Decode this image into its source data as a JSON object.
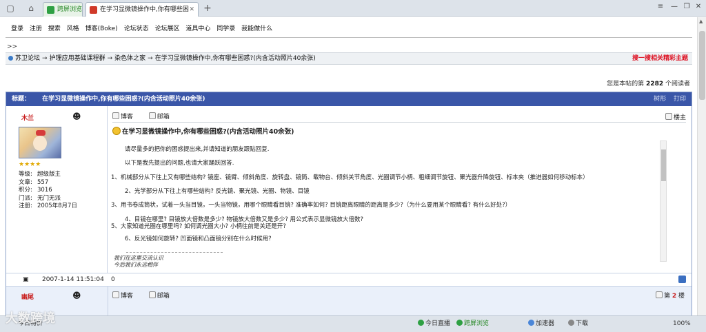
{
  "browser": {
    "tabs": [
      {
        "label": "跨屏浏览"
      },
      {
        "label": "在学习显微镜操作中,你有哪些困"
      }
    ],
    "new_tab": "+",
    "win_controls": [
      "≡",
      "—",
      "❐",
      "✕"
    ]
  },
  "topnav": [
    "登录",
    "注册",
    "搜索",
    "风格",
    "博客(Boke)",
    "论坛状态",
    "论坛展区",
    "道具中心",
    "同学录",
    "我能做什么"
  ],
  "gtgt": ">>",
  "breadcrumb": {
    "items": [
      "苏卫论坛",
      "护理应用基础课程群",
      "染色体之家",
      "在学习显微镜操作中,你有哪些困惑?(内含活动照片40余张)"
    ],
    "arrow": "→",
    "search_label": "搜一搜相关精彩主题"
  },
  "readers": {
    "prefix": "您是本帖的第",
    "count": "2282",
    "suffix": "个阅读者"
  },
  "thread": {
    "label": "标题：",
    "title": "在学习显微镜操作中,你有哪些困惑?(内含活动照片40余张)",
    "tools": [
      "树形",
      "打印"
    ]
  },
  "post1": {
    "author": "木兰",
    "stars": "★★★★",
    "info": [
      {
        "k": "等级:",
        "v": "超级版主"
      },
      {
        "k": "文章:",
        "v": "557"
      },
      {
        "k": "积分:",
        "v": "3016"
      },
      {
        "k": "门派:",
        "v": "无门无派"
      },
      {
        "k": "注册:",
        "v": "2005年8月7日"
      }
    ],
    "actions": [
      "博客",
      "邮箱"
    ],
    "floor": "楼主",
    "title": "在学习显微镜操作中,你有哪些困惑?(内含活动照片40余张)",
    "lines": [
      "请尽量多的把你的困惑提出来,并请知道的朋友跟贴回复.",
      "以下是我先提出的问题,也请大家踊跃回答.",
      "1、机械部分从下往上又有哪些结构? 镜座、镜臂、倾斜角度、旋转盘、镜筒、载物台、倾斜关节角度、光圈调节小柄、粗细调节旋钮、聚光器升降旋钮、标本夹（推进器如何移动标本）",
      "2、光学部分从下往上有哪些结构? 反光镜、聚光镜、光圈、物镜、目镜",
      "3、用书卷成筒状，试着一头当目镜，一头当物镜，用哪个眼睛看目镜? 准确率如何? 目镜距离眼睛的距离是多少?（为什么要用某个眼睛看? 有什么好处?）",
      "4、目镜在哪里? 目镜放大倍数是多少? 物镜放大倍数又是多少? 用公式表示显微镜放大倍数?",
      "5、大家知道光圈在哪里吗? 如何调光圈大小? 小柄往前是关还是开?",
      "6、反光镜如何旋转? 凹面镜和凸面镜分别在什么时候用?"
    ],
    "signature": "我们在这里交流认识\n今后我们永远相伴",
    "time": "2007-1-14 11:51:04",
    "score": "0"
  },
  "post2": {
    "author": "幽尾",
    "actions": [
      "博客",
      "邮箱"
    ],
    "floor_prefix": "第",
    "floor_num": "2",
    "floor_suffix": "楼"
  },
  "statusbar": {
    "left": "今日特价",
    "items": [
      "今日直播",
      "跨屏浏览",
      "加速器",
      "下载",
      "100%"
    ]
  },
  "watermark": "大数跨境"
}
